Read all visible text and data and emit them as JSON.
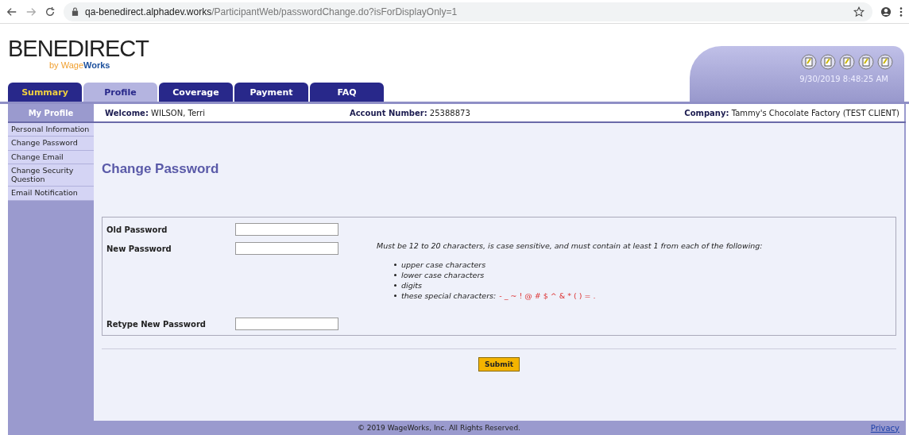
{
  "browser": {
    "host": "qa-benedirect.alphadev.works",
    "path": "/ParticipantWeb/passwordChange.do?isForDisplayOnly=1"
  },
  "logo": {
    "name": "**BENE**DIRECT",
    "byline": "by Wage**Works**"
  },
  "tabs": [
    {
      "label": "Summary",
      "selected": false,
      "highlight": true
    },
    {
      "label": "Profile",
      "selected": true,
      "highlight": false
    },
    {
      "label": "Coverage",
      "selected": false,
      "highlight": false
    },
    {
      "label": "Payment",
      "selected": false,
      "highlight": false
    },
    {
      "label": "FAQ",
      "selected": false,
      "highlight": false
    }
  ],
  "datetime": "9/30/2019 8:48:25 AM",
  "info_bar": {
    "section": "My Profile",
    "welcome_label": "Welcome:",
    "welcome_value": "WILSON, Terri",
    "account_label": "Account Number:",
    "account_value": "25388873",
    "company_label": "Company:",
    "company_value": "Tammy's Chocolate Factory (TEST CLIENT)"
  },
  "sidebar": {
    "items": [
      "Personal Information",
      "Change Password",
      "Change Email",
      "Change Security Question",
      "Email Notification"
    ]
  },
  "page_title": "Change Password",
  "fields": [
    {
      "label": "Old Password"
    },
    {
      "label": "New Password"
    },
    {
      "label": "Retype New Password"
    }
  ],
  "rules": {
    "intro": "Must be 12 to 20 characters, is case sensitive, and must contain at least 1 from each of the following:",
    "items": [
      "upper case characters",
      "lower case characters",
      "digits",
      "these special characters:"
    ],
    "special": "- _ ~ ! @ # $ ^ & * ( ) = ."
  },
  "submit": "Submit",
  "footer": {
    "copyright": "© 2019 WageWorks, Inc. All Rights Reserved.",
    "link": "Privacy"
  }
}
